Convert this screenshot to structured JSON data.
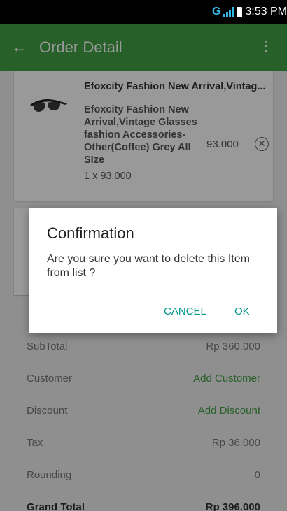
{
  "status_bar": {
    "network": "G",
    "time": "3:53 PM"
  },
  "app_bar": {
    "title": "Order Detail"
  },
  "order_item": {
    "title": "Efoxcity Fashion New Arrival,Vintag...",
    "description": "Efoxcity Fashion New Arrival,Vintage Glasses fashion Accessories-Other(Coffee) Grey All SIze",
    "price": "93.000",
    "quantity_line": "1 x 93.000"
  },
  "summary": {
    "rows": [
      {
        "label": "SubTotal",
        "value": "Rp 360.000"
      },
      {
        "label": "Customer",
        "value": "Add Customer"
      },
      {
        "label": "Discount",
        "value": "Add Discount"
      },
      {
        "label": "Tax",
        "value": "Rp 36.000"
      },
      {
        "label": "Rounding",
        "value": "0"
      },
      {
        "label": "Grand Total",
        "value": "Rp 396.000"
      }
    ]
  },
  "dialog": {
    "title": "Confirmation",
    "message": "Are you sure you want to delete this Item from list ?",
    "cancel_label": "CANCEL",
    "ok_label": "OK"
  },
  "colors": {
    "primary": "#43a047",
    "accent": "#009688",
    "network": "#33b5e5"
  },
  "icons": {
    "back": "arrow-left-icon",
    "menu": "overflow-menu-icon",
    "remove": "remove-circle-icon",
    "product": "sunglasses-icon"
  }
}
